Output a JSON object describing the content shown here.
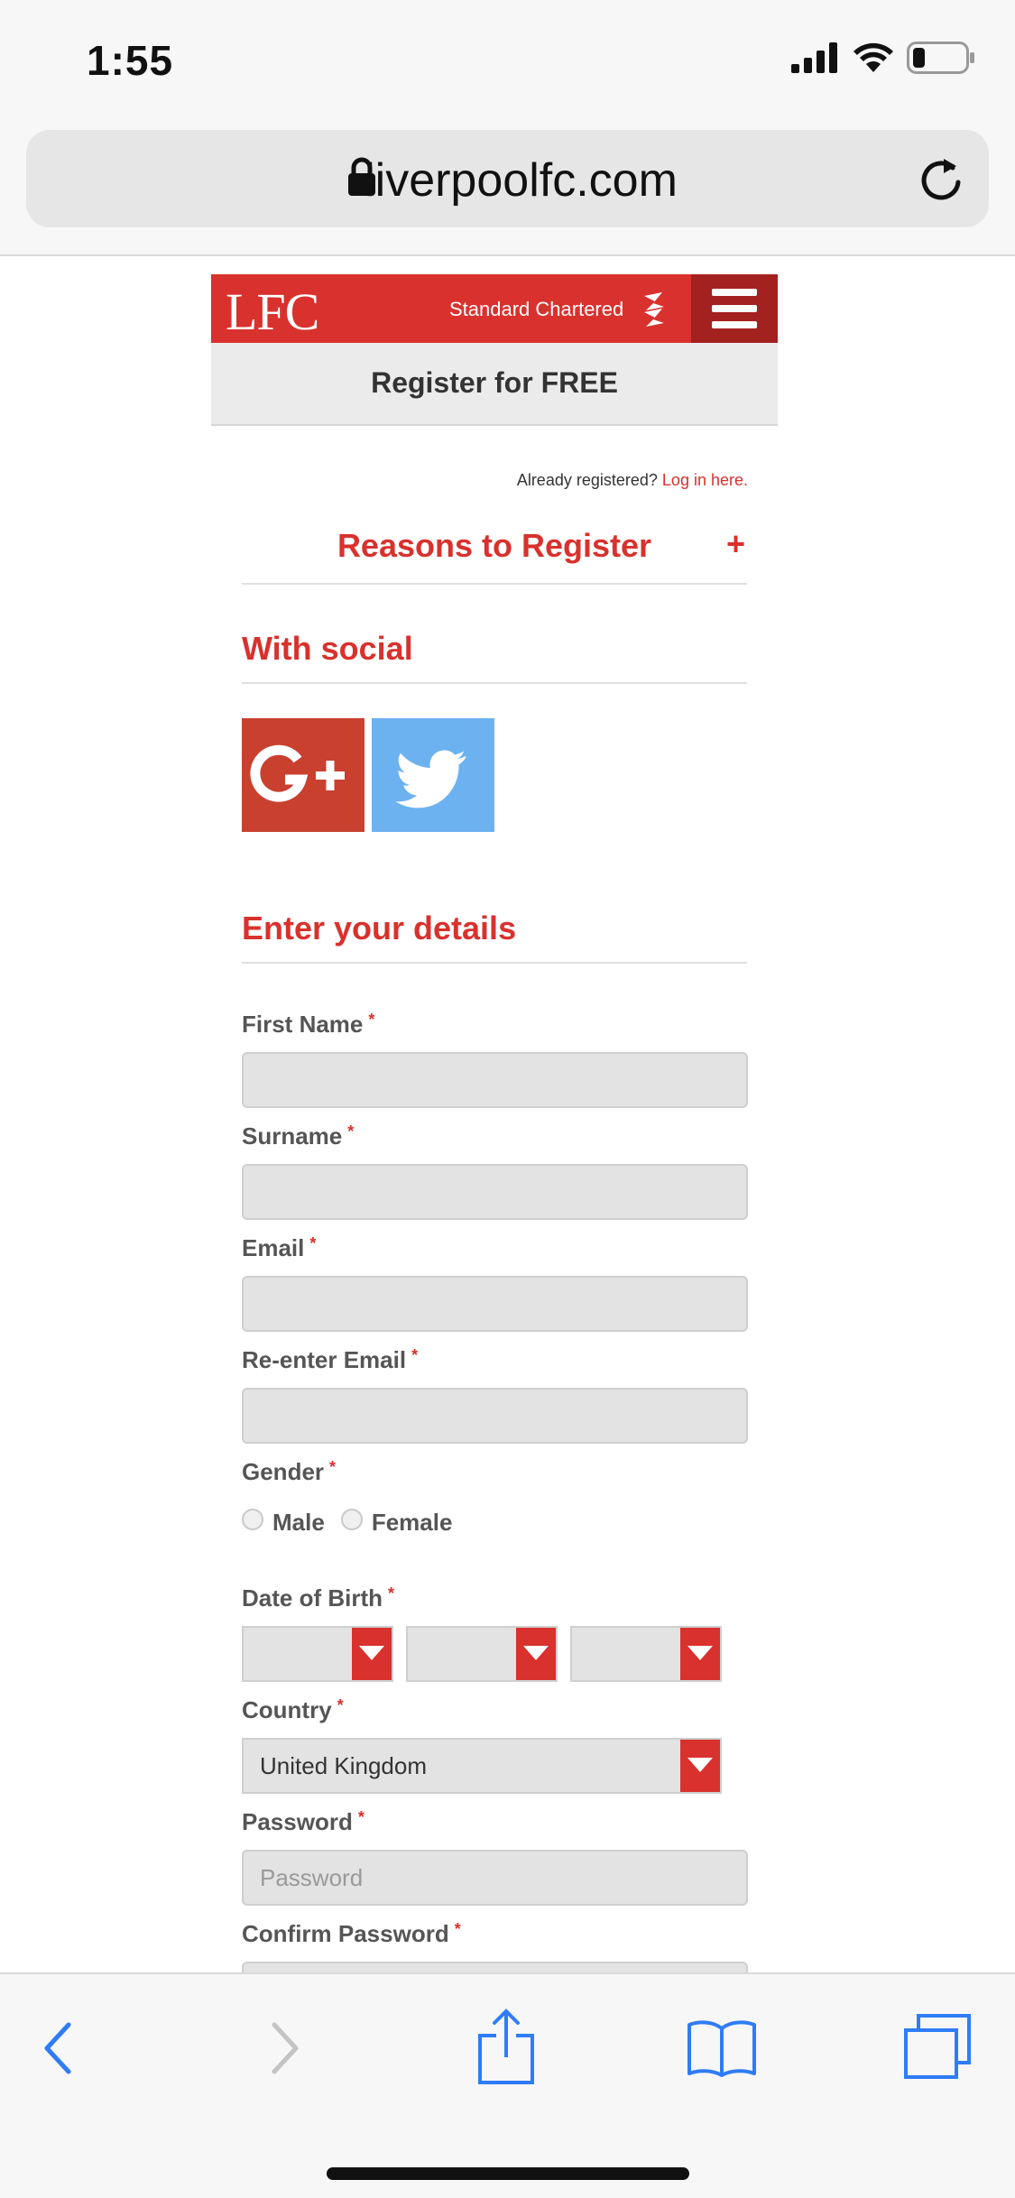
{
  "status_bar": {
    "time": "1:55"
  },
  "browser": {
    "url": "liverpoolfc.com"
  },
  "header": {
    "logo": "LFC",
    "sponsor": "Standard Chartered",
    "register_title": "Register for FREE"
  },
  "login_prompt": {
    "text": "Already registered?",
    "link": "Log in here."
  },
  "reasons": {
    "title": "Reasons to Register",
    "toggle": "+"
  },
  "social": {
    "heading": "With social",
    "google_label": "G+"
  },
  "details": {
    "heading": "Enter your details",
    "required_mark": "*",
    "first_name_label": "First Name",
    "surname_label": "Surname",
    "email_label": "Email",
    "reenter_email_label": "Re-enter Email",
    "gender_label": "Gender",
    "gender_options": [
      "Male",
      "Female"
    ],
    "dob_label": "Date of Birth",
    "country_label": "Country",
    "country_value": "United Kingdom",
    "password_label": "Password",
    "password_placeholder": "Password",
    "confirm_password_label": "Confirm Password"
  },
  "colors": {
    "brand_red": "#d9312d",
    "google_red": "#c9402f",
    "twitter_blue": "#6cb2f1",
    "ios_blue": "#2f7cf6"
  },
  "icons": [
    "lock-icon",
    "reload-icon",
    "back-icon",
    "forward-icon",
    "share-icon",
    "bookmarks-icon",
    "tabs-icon"
  ]
}
